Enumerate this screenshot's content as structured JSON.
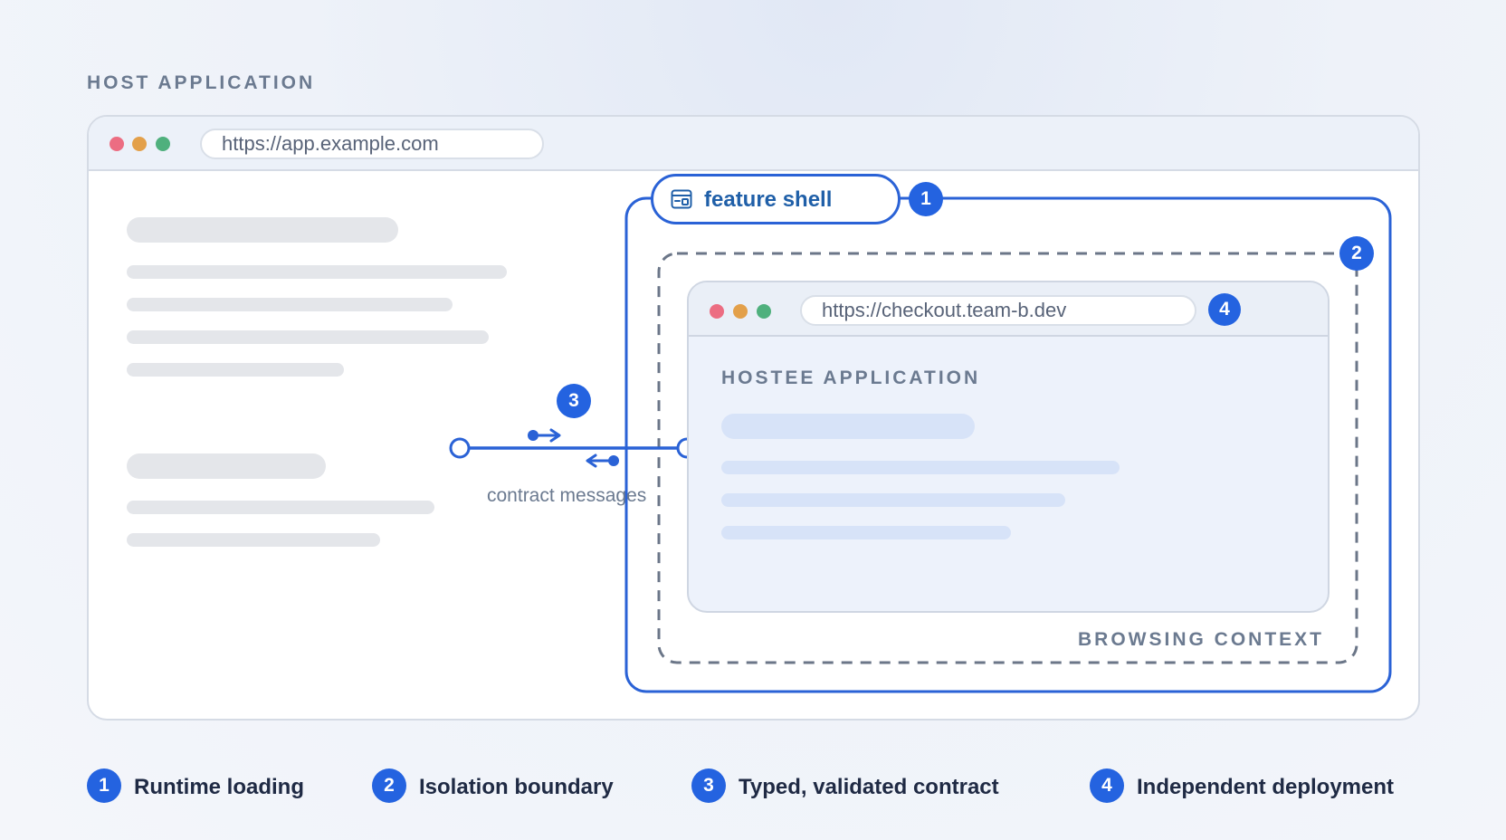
{
  "host": {
    "title": "HOST APPLICATION",
    "url": "https://app.example.com"
  },
  "shell": {
    "label": "feature shell",
    "badge": "1"
  },
  "hostee": {
    "title": "HOSTEE APPLICATION",
    "url": "https://checkout.team-b.dev",
    "url_badge": "4"
  },
  "boundary": {
    "label": "BROWSING CONTEXT",
    "badge": "2"
  },
  "contract": {
    "label": "contract messages",
    "badge": "3"
  },
  "legend": [
    {
      "number": "1",
      "label": "Runtime loading"
    },
    {
      "number": "2",
      "label": "Isolation boundary"
    },
    {
      "number": "3",
      "label": "Typed, validated contract"
    },
    {
      "number": "4",
      "label": "Independent deployment"
    }
  ],
  "colors": {
    "accent": "#2463e0",
    "outline": "#2a62d6",
    "dashed": "#6b7688",
    "muted_text": "#6b7a90",
    "dot_red": "#ec6d82",
    "dot_amber": "#e3a04a",
    "dot_green": "#4fb07d"
  },
  "icons": {
    "shell": "browser-window-icon"
  }
}
